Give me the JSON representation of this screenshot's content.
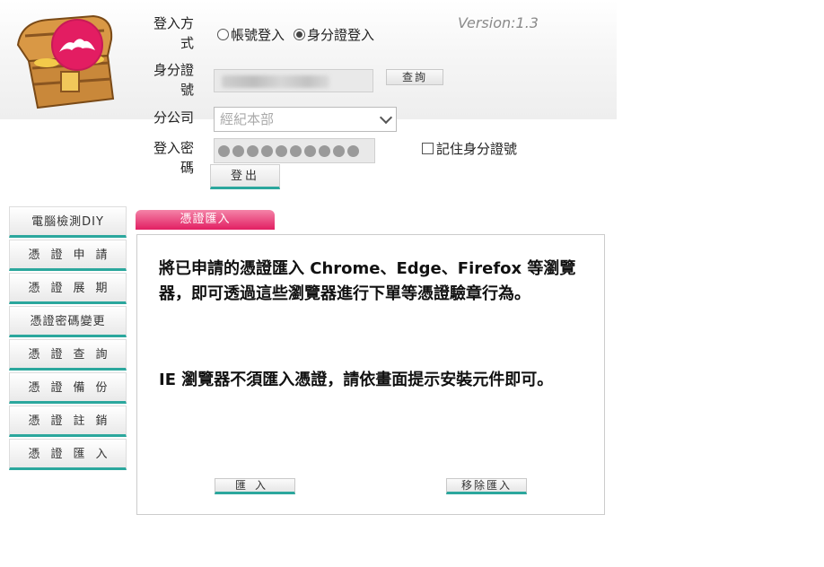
{
  "header": {
    "version": "Version:1.3",
    "login_method_label": "登入方式",
    "login_method_options": [
      "帳號登入",
      "身分證登入"
    ],
    "login_method_selected": "身分證登入",
    "id_label": "身分證號",
    "query_button": "查詢",
    "branch_label": "分公司",
    "branch_value": "經紀本部",
    "password_label": "登入密碼",
    "remember_label": "記住身分證號",
    "remember_checked": false,
    "logout_button": "登出"
  },
  "sidebar": {
    "items": [
      {
        "label": "電腦檢測DIY"
      },
      {
        "label": "憑證申請"
      },
      {
        "label": "憑證展期"
      },
      {
        "label": "憑證密碼變更"
      },
      {
        "label": "憑證查詢"
      },
      {
        "label": "憑證備份"
      },
      {
        "label": "憑證註銷"
      },
      {
        "label": "憑證匯入"
      }
    ]
  },
  "main": {
    "tab_label": "憑證匯入",
    "message1": "將已申請的憑證匯入 Chrome、Edge、Firefox 等瀏覽器，即可透過這些瀏覽器進行下單等憑證驗章行為。",
    "message2": "IE 瀏覽器不須匯入憑證，請依畫面提示安裝元件即可。",
    "import_button": "匯入",
    "remove_button": "移除匯入"
  },
  "colors": {
    "accent_teal": "#2ba79d",
    "tab_pink": "#e21f62"
  }
}
